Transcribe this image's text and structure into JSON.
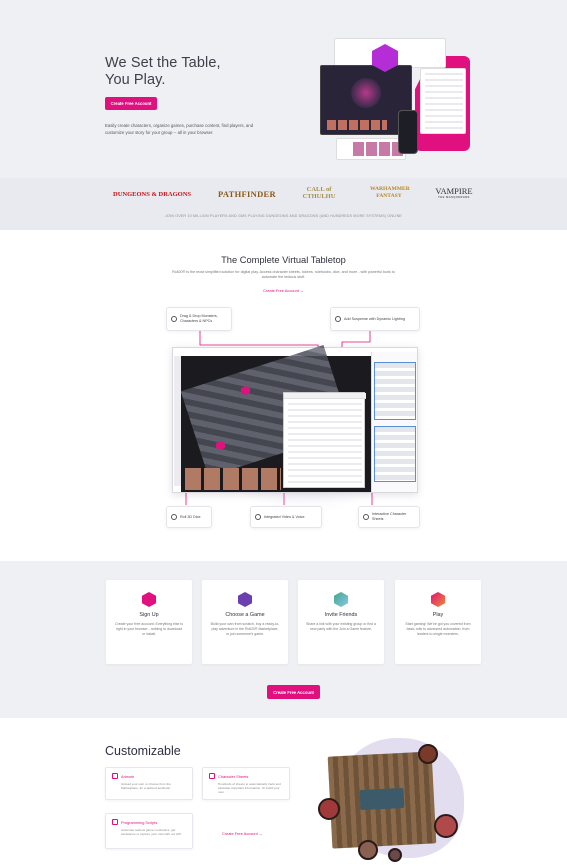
{
  "hero": {
    "title_line1": "We Set the Table,",
    "title_line2": "You Play.",
    "cta": "Create Free Account",
    "description": "Easily create characters, organize games, purchase content, find players, and customize your story for your group -- all in your browser."
  },
  "logos": {
    "items": [
      "DUNGEONS & DRAGONS",
      "PATHFINDER",
      "CALL of CTHULHU",
      "WARHAMMER FANTASY",
      "VAMPIRE"
    ],
    "vampire_sub": "THE MASQUERADE",
    "caption": "JOIN OVER 10 MILLION PLAYERS AND GMS PLAYING DUNGEONS AND DRAGONS (AND HUNDREDS MORE SYSTEMS) ONLINE"
  },
  "vtt": {
    "title": "The Complete Virtual Tabletop",
    "description": "Roll20® is the most simplified solution for digital play. Access character sheets, tokens, rulebooks, dice, and more - with powerful tools to automate the tedious stuff.",
    "link": "Create Free Account",
    "callouts": {
      "drag_drop": "Drag & Drop Monsters, Characters & NPCs",
      "lighting": "Add Suspense with Dynamic Lighting",
      "dice": "Roll 3D Dice",
      "video": "Integrated Video & Voice",
      "sheets": "Interactive Character Sheets"
    }
  },
  "steps": {
    "cards": [
      {
        "title": "Sign Up",
        "text": "Create your free account. Everything else is right in your browser - nothing to download or install.",
        "color": "#e0107f"
      },
      {
        "title": "Choose a Game",
        "text": "Build your own from scratch, buy a ready-to-play adventure in the Roll20® Marketplace, or join someone's game.",
        "color": "#6b3fb0"
      },
      {
        "title": "Invite Friends",
        "text": "Share a link with your existing group or find a new party with the Join a Game feature.",
        "color": "#3fa68a"
      },
      {
        "title": "Play",
        "text": "Start gaming! We've got you covered from basic rolls to advanced automation, from leaders to single monsters.",
        "color": "#e85a3a"
      }
    ],
    "cta": "Create Free Account"
  },
  "customizable": {
    "title": "Customizable",
    "cards": [
      {
        "title": "Artwork",
        "text": "Upload your own or choose from the Marketplace, for a tailored aesthetic."
      },
      {
        "title": "Character Sheets",
        "text": "Hundreds of sheets to automatically track and calculate important information. Or build your own."
      },
      {
        "title": "Programming Scripts",
        "text": "Automate tedious game mechanics, get assistance or explore your own with our API."
      }
    ],
    "link": "Create Free Account"
  },
  "colors": {
    "accent": "#e0107f",
    "hero_bg": "#eff0f4",
    "band_bg": "#e8eaf0"
  },
  "icons": [
    "arrow-right-icon",
    "drag-drop-icon",
    "lightbulb-icon",
    "d20-icon",
    "video-icon",
    "sheet-icon"
  ]
}
